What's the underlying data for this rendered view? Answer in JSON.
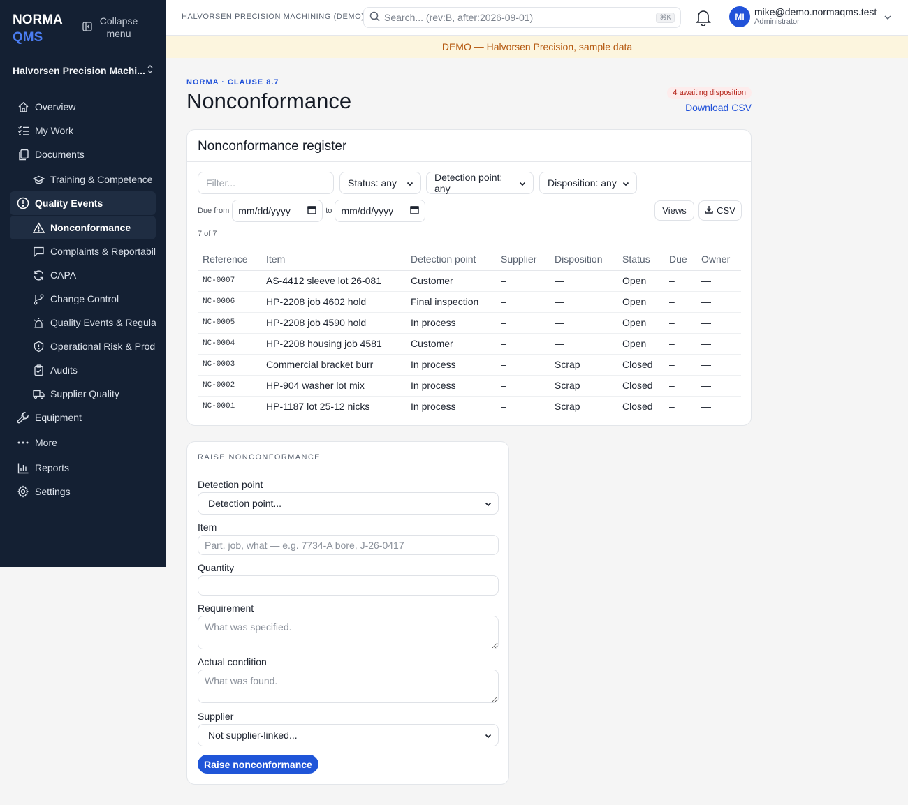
{
  "brand": {
    "line1": "NORMA",
    "line2": "QMS"
  },
  "sidebar": {
    "collapse_label": "Collapse menu",
    "org_name": "Halvorsen Precision Machi...",
    "items": [
      {
        "label": "Overview",
        "icon": "home-icon"
      },
      {
        "label": "My Work",
        "icon": "checklist-icon"
      },
      {
        "label": "Documents",
        "icon": "documents-icon"
      },
      {
        "label": "Training & Competence",
        "icon": "graduation-cap-icon"
      },
      {
        "label": "Quality Events",
        "icon": "alert-circle-icon"
      },
      {
        "label": "Nonconformance",
        "icon": "warning-triangle-icon"
      },
      {
        "label": "Complaints & Reportability",
        "icon": "message-square-icon"
      },
      {
        "label": "CAPA",
        "icon": "refresh-icon"
      },
      {
        "label": "Change Control",
        "icon": "git-branch-icon"
      },
      {
        "label": "Quality Events & Regulatory",
        "icon": "siren-icon"
      },
      {
        "label": "Operational Risk & Product",
        "icon": "shield-icon"
      },
      {
        "label": "Audits",
        "icon": "clipboard-check-icon"
      },
      {
        "label": "Supplier Quality",
        "icon": "truck-icon"
      },
      {
        "label": "Equipment",
        "icon": "wrench-icon"
      },
      {
        "label": "More",
        "icon": "more-dots-icon"
      },
      {
        "label": "Reports",
        "icon": "bar-chart-icon"
      },
      {
        "label": "Settings",
        "icon": "gear-icon"
      }
    ]
  },
  "topbar": {
    "tenant": "HALVORSEN PRECISION MACHINING (DEMO)",
    "search_placeholder": "Search... (rev:B, after:2026-09-01)",
    "search_shortcut": "⌘K",
    "user_initials": "MI",
    "user_email": "mike@demo.normaqms.test",
    "user_role": "Administrator"
  },
  "banner": "DEMO — Halvorsen Precision, sample data",
  "page": {
    "crumb": "NORMA · CLAUSE 8.7",
    "title": "Nonconformance",
    "awaiting": "4 awaiting disposition",
    "download": "Download CSV"
  },
  "register": {
    "title": "Nonconformance register",
    "filter_placeholder": "Filter...",
    "status_select": "Status: any",
    "detection_select": "Detection point: any",
    "disposition_select": "Disposition: any",
    "due_from_label": "Due from",
    "to_label": "to",
    "date_placeholder": "mm/dd/yyyy",
    "views_label": "Views",
    "csv_label": "CSV",
    "count": "7 of 7",
    "columns": [
      "Reference",
      "Item",
      "Detection point",
      "Supplier",
      "Disposition",
      "Status",
      "Due",
      "Owner"
    ],
    "rows": [
      [
        "NC-0007",
        "AS-4412 sleeve lot 26-081",
        "Customer",
        "–",
        "—",
        "Open",
        "–",
        "—"
      ],
      [
        "NC-0006",
        "HP-2208 job 4602 hold",
        "Final inspection",
        "–",
        "—",
        "Open",
        "–",
        "—"
      ],
      [
        "NC-0005",
        "HP-2208 job 4590 hold",
        "In process",
        "–",
        "—",
        "Open",
        "–",
        "—"
      ],
      [
        "NC-0004",
        "HP-2208 housing job 4581",
        "Customer",
        "–",
        "—",
        "Open",
        "–",
        "—"
      ],
      [
        "NC-0003",
        "Commercial bracket burr",
        "In process",
        "–",
        "Scrap",
        "Closed",
        "–",
        "—"
      ],
      [
        "NC-0002",
        "HP-904 washer lot mix",
        "In process",
        "–",
        "Scrap",
        "Closed",
        "–",
        "—"
      ],
      [
        "NC-0001",
        "HP-1187 lot 25-12 nicks",
        "In process",
        "–",
        "Scrap",
        "Closed",
        "–",
        "—"
      ]
    ]
  },
  "raise": {
    "heading": "RAISE NONCONFORMANCE",
    "detection_label": "Detection point",
    "detection_value": "Detection point...",
    "item_label": "Item",
    "item_placeholder": "Part, job, what — e.g. 7734-A bore, J-26-0417",
    "quantity_label": "Quantity",
    "requirement_label": "Requirement",
    "requirement_placeholder": "What was specified.",
    "actual_label": "Actual condition",
    "actual_placeholder": "What was found.",
    "supplier_label": "Supplier",
    "supplier_value": "Not supplier-linked...",
    "submit_label": "Raise nonconformance"
  },
  "colors": {
    "sidebar_bg": "#142033",
    "accent": "#2152d9",
    "banner_bg": "#fcf5de",
    "banner_text": "#b4570e",
    "badge_text": "#b42318"
  }
}
